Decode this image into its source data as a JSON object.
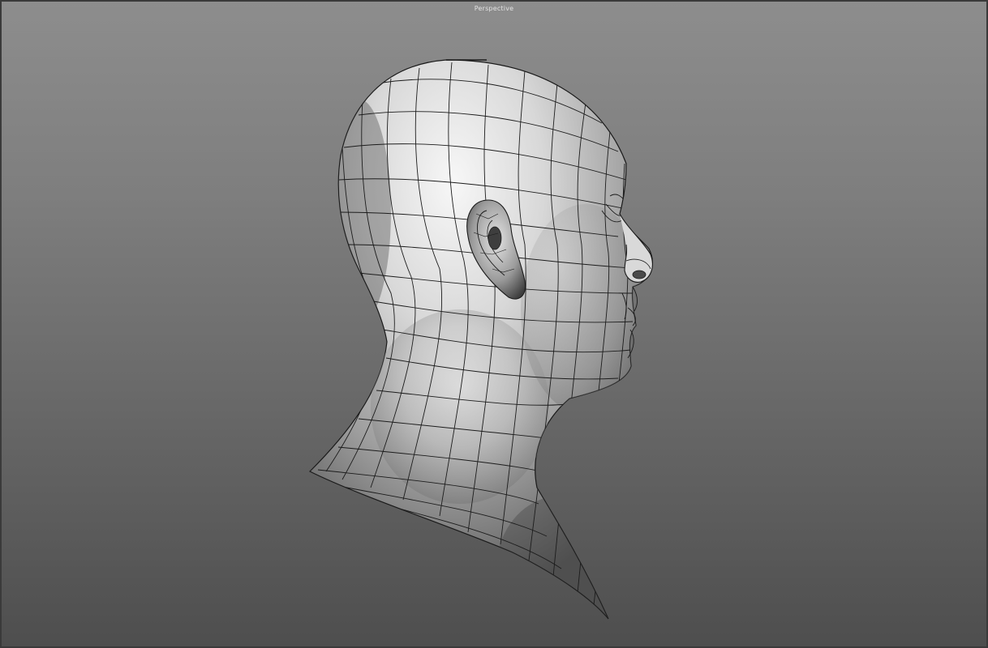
{
  "viewport": {
    "label": "Perspective",
    "object": "head-mesh"
  },
  "colors": {
    "background_top": "#8d8d8d",
    "background_bottom": "#4e4e4e",
    "wireframe": "#1c1c1c",
    "surface_light": "#f2f2f2",
    "surface_dark": "#3a3a3a"
  }
}
